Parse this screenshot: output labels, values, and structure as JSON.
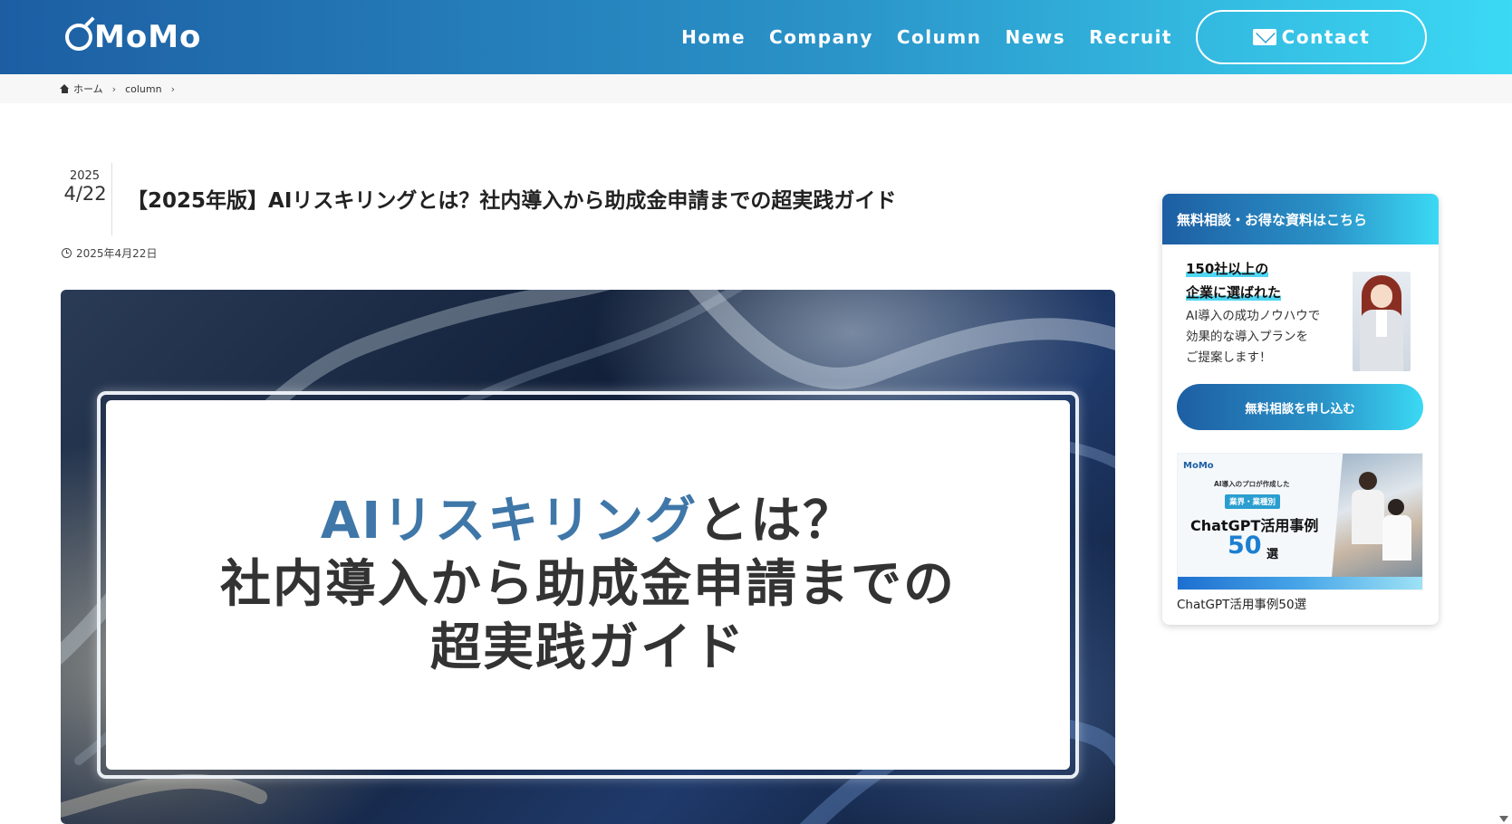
{
  "header": {
    "logo": "MoMo",
    "nav": [
      "Home",
      "Company",
      "Column",
      "News",
      "Recruit"
    ],
    "contact_label": "Contact"
  },
  "breadcrumb": {
    "home": "ホーム",
    "items": [
      "column"
    ]
  },
  "article": {
    "year": "2025",
    "month_day": "4/22",
    "title": "【2025年版】AIリスキリングとは？社内導入から助成金申請までの超実践ガイド",
    "published": "2025年4月22日",
    "hero": {
      "line1_accent": "AIリスキリング",
      "line1_rest": "とは？",
      "line2": "社内導入から助成金申請までの",
      "line3": "超実践ガイド"
    }
  },
  "sidebar": {
    "heading": "無料相談・お得な資料はこちら",
    "highlight_line1": "150社以上の",
    "highlight_line2": "企業に選ばれた",
    "body_lines": [
      "AI導入の成功ノウハウで",
      "効果的な導入プランを",
      "ご提案します！"
    ],
    "cta_label": "無料相談を申し込む",
    "banner": {
      "logo": "MoMo",
      "subtitle": "AI導入のプロが作成した",
      "tag": "業界・業種別",
      "title": "ChatGPT活用事例",
      "number": "50",
      "suffix": "選"
    },
    "banner_caption": "ChatGPT活用事例50選"
  },
  "colors": {
    "brand_start": "#1d5ea3",
    "brand_end": "#3bd9f4",
    "hero_accent": "#3f77a8"
  }
}
